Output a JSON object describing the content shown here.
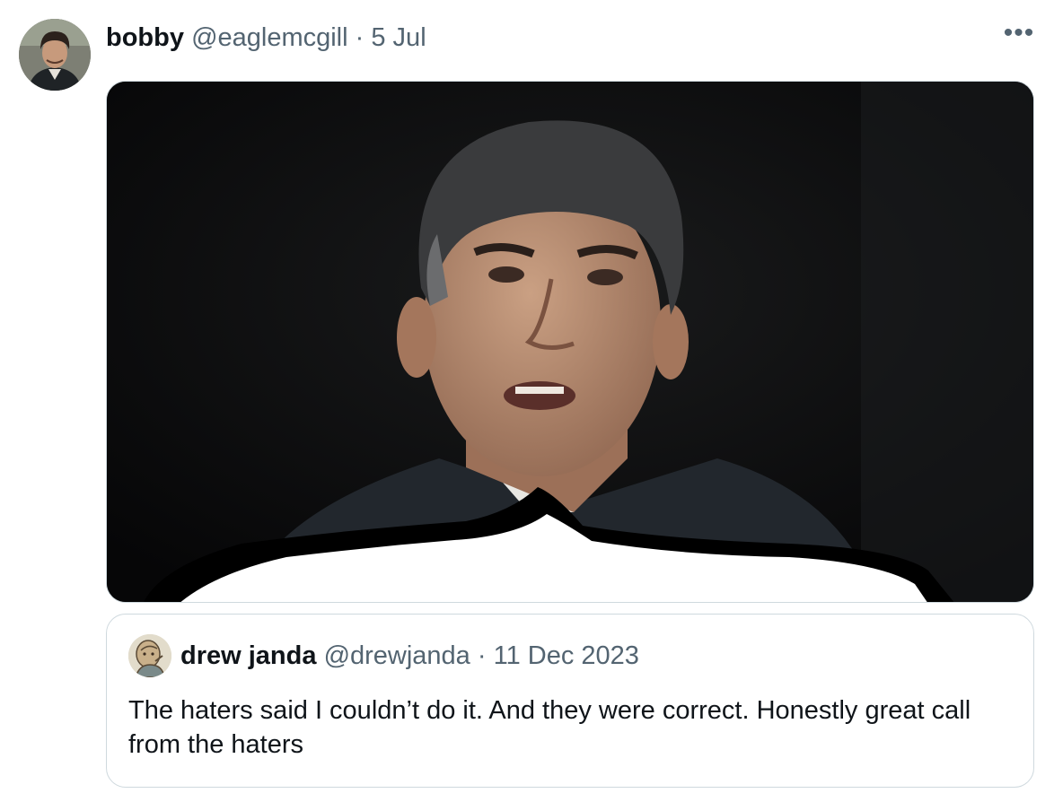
{
  "tweet": {
    "display_name": "bobby",
    "handle": "@eaglemcgill",
    "separator": "·",
    "date": "5 Jul",
    "more_label": "•••",
    "avatar_icon": "user-avatar-photo",
    "media_icon": "photo-of-man-in-suit-with-white-shape"
  },
  "quoted_tweet": {
    "display_name": "drew janda",
    "handle": "@drewjanda",
    "separator": "·",
    "date": "11 Dec 2023",
    "text": "The haters said I couldn’t do it. And they were correct. Honestly great call from the haters",
    "avatar_icon": "user-avatar-illustration"
  },
  "colors": {
    "text_primary": "#0f1419",
    "text_secondary": "#536471",
    "border": "#cfd9de"
  }
}
